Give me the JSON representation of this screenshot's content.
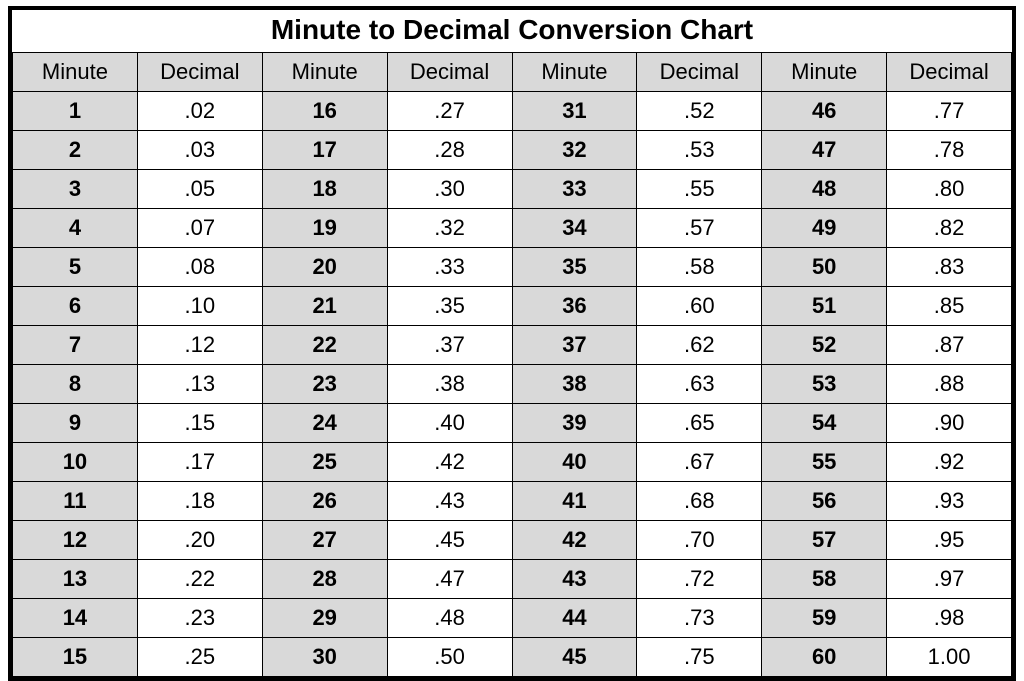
{
  "title": "Minute to Decimal Conversion Chart",
  "headers": {
    "minute": "Minute",
    "decimal": "Decimal"
  },
  "columns": [
    {
      "rows": [
        {
          "minute": "1",
          "decimal": ".02"
        },
        {
          "minute": "2",
          "decimal": ".03"
        },
        {
          "minute": "3",
          "decimal": ".05"
        },
        {
          "minute": "4",
          "decimal": ".07"
        },
        {
          "minute": "5",
          "decimal": ".08"
        },
        {
          "minute": "6",
          "decimal": ".10"
        },
        {
          "minute": "7",
          "decimal": ".12"
        },
        {
          "minute": "8",
          "decimal": ".13"
        },
        {
          "minute": "9",
          "decimal": ".15"
        },
        {
          "minute": "10",
          "decimal": ".17"
        },
        {
          "minute": "11",
          "decimal": ".18"
        },
        {
          "minute": "12",
          "decimal": ".20"
        },
        {
          "minute": "13",
          "decimal": ".22"
        },
        {
          "minute": "14",
          "decimal": ".23"
        },
        {
          "minute": "15",
          "decimal": ".25"
        }
      ]
    },
    {
      "rows": [
        {
          "minute": "16",
          "decimal": ".27"
        },
        {
          "minute": "17",
          "decimal": ".28"
        },
        {
          "minute": "18",
          "decimal": ".30"
        },
        {
          "minute": "19",
          "decimal": ".32"
        },
        {
          "minute": "20",
          "decimal": ".33"
        },
        {
          "minute": "21",
          "decimal": ".35"
        },
        {
          "minute": "22",
          "decimal": ".37"
        },
        {
          "minute": "23",
          "decimal": ".38"
        },
        {
          "minute": "24",
          "decimal": ".40"
        },
        {
          "minute": "25",
          "decimal": ".42"
        },
        {
          "minute": "26",
          "decimal": ".43"
        },
        {
          "minute": "27",
          "decimal": ".45"
        },
        {
          "minute": "28",
          "decimal": ".47"
        },
        {
          "minute": "29",
          "decimal": ".48"
        },
        {
          "minute": "30",
          "decimal": ".50"
        }
      ]
    },
    {
      "rows": [
        {
          "minute": "31",
          "decimal": ".52"
        },
        {
          "minute": "32",
          "decimal": ".53"
        },
        {
          "minute": "33",
          "decimal": ".55"
        },
        {
          "minute": "34",
          "decimal": ".57"
        },
        {
          "minute": "35",
          "decimal": ".58"
        },
        {
          "minute": "36",
          "decimal": ".60"
        },
        {
          "minute": "37",
          "decimal": ".62"
        },
        {
          "minute": "38",
          "decimal": ".63"
        },
        {
          "minute": "39",
          "decimal": ".65"
        },
        {
          "minute": "40",
          "decimal": ".67"
        },
        {
          "minute": "41",
          "decimal": ".68"
        },
        {
          "minute": "42",
          "decimal": ".70"
        },
        {
          "minute": "43",
          "decimal": ".72"
        },
        {
          "minute": "44",
          "decimal": ".73"
        },
        {
          "minute": "45",
          "decimal": ".75"
        }
      ]
    },
    {
      "rows": [
        {
          "minute": "46",
          "decimal": ".77"
        },
        {
          "minute": "47",
          "decimal": ".78"
        },
        {
          "minute": "48",
          "decimal": ".80"
        },
        {
          "minute": "49",
          "decimal": ".82"
        },
        {
          "minute": "50",
          "decimal": ".83"
        },
        {
          "minute": "51",
          "decimal": ".85"
        },
        {
          "minute": "52",
          "decimal": ".87"
        },
        {
          "minute": "53",
          "decimal": ".88"
        },
        {
          "minute": "54",
          "decimal": ".90"
        },
        {
          "minute": "55",
          "decimal": ".92"
        },
        {
          "minute": "56",
          "decimal": ".93"
        },
        {
          "minute": "57",
          "decimal": ".95"
        },
        {
          "minute": "58",
          "decimal": ".97"
        },
        {
          "minute": "59",
          "decimal": ".98"
        },
        {
          "minute": "60",
          "decimal": "1.00"
        }
      ]
    }
  ],
  "chart_data": {
    "type": "table",
    "title": "Minute to Decimal Conversion Chart",
    "columns": [
      "Minute",
      "Decimal"
    ],
    "rows": [
      [
        1,
        0.02
      ],
      [
        2,
        0.03
      ],
      [
        3,
        0.05
      ],
      [
        4,
        0.07
      ],
      [
        5,
        0.08
      ],
      [
        6,
        0.1
      ],
      [
        7,
        0.12
      ],
      [
        8,
        0.13
      ],
      [
        9,
        0.15
      ],
      [
        10,
        0.17
      ],
      [
        11,
        0.18
      ],
      [
        12,
        0.2
      ],
      [
        13,
        0.22
      ],
      [
        14,
        0.23
      ],
      [
        15,
        0.25
      ],
      [
        16,
        0.27
      ],
      [
        17,
        0.28
      ],
      [
        18,
        0.3
      ],
      [
        19,
        0.32
      ],
      [
        20,
        0.33
      ],
      [
        21,
        0.35
      ],
      [
        22,
        0.37
      ],
      [
        23,
        0.38
      ],
      [
        24,
        0.4
      ],
      [
        25,
        0.42
      ],
      [
        26,
        0.43
      ],
      [
        27,
        0.45
      ],
      [
        28,
        0.47
      ],
      [
        29,
        0.48
      ],
      [
        30,
        0.5
      ],
      [
        31,
        0.52
      ],
      [
        32,
        0.53
      ],
      [
        33,
        0.55
      ],
      [
        34,
        0.57
      ],
      [
        35,
        0.58
      ],
      [
        36,
        0.6
      ],
      [
        37,
        0.62
      ],
      [
        38,
        0.63
      ],
      [
        39,
        0.65
      ],
      [
        40,
        0.67
      ],
      [
        41,
        0.68
      ],
      [
        42,
        0.7
      ],
      [
        43,
        0.72
      ],
      [
        44,
        0.73
      ],
      [
        45,
        0.75
      ],
      [
        46,
        0.77
      ],
      [
        47,
        0.78
      ],
      [
        48,
        0.8
      ],
      [
        49,
        0.82
      ],
      [
        50,
        0.83
      ],
      [
        51,
        0.85
      ],
      [
        52,
        0.87
      ],
      [
        53,
        0.88
      ],
      [
        54,
        0.9
      ],
      [
        55,
        0.92
      ],
      [
        56,
        0.93
      ],
      [
        57,
        0.95
      ],
      [
        58,
        0.97
      ],
      [
        59,
        0.98
      ],
      [
        60,
        1.0
      ]
    ]
  }
}
